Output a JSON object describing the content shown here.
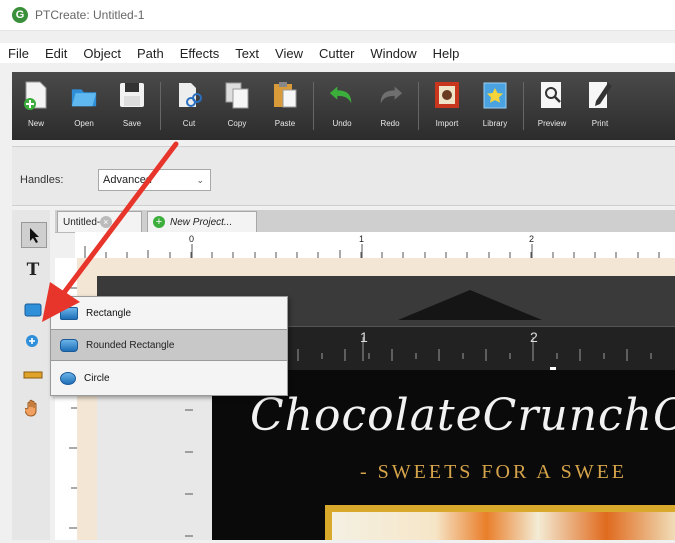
{
  "window": {
    "title": "PTCreate: Untitled-1",
    "logo_letter": "G"
  },
  "menu": [
    "File",
    "Edit",
    "Object",
    "Path",
    "Effects",
    "Text",
    "View",
    "Cutter",
    "Window",
    "Help"
  ],
  "toolbar": {
    "buttons": [
      {
        "label": "New",
        "icon": "new-document-icon"
      },
      {
        "label": "Open",
        "icon": "open-folder-icon"
      },
      {
        "label": "Save",
        "icon": "save-floppy-icon"
      },
      {
        "label": "Cut",
        "icon": "scissors-icon"
      },
      {
        "label": "Copy",
        "icon": "copy-icon"
      },
      {
        "label": "Paste",
        "icon": "paste-clipboard-icon"
      },
      {
        "label": "Undo",
        "icon": "undo-arrow-icon"
      },
      {
        "label": "Redo",
        "icon": "redo-arrow-icon"
      },
      {
        "label": "Import",
        "icon": "import-icon"
      },
      {
        "label": "Library",
        "icon": "library-star-icon"
      },
      {
        "label": "Preview",
        "icon": "preview-magnifier-icon"
      },
      {
        "label": "Print",
        "icon": "print-pen-icon"
      }
    ]
  },
  "handles": {
    "label": "Handles:",
    "value": "Advanced"
  },
  "tabs": [
    {
      "label": "Untitled-1"
    },
    {
      "label": "New Project..."
    }
  ],
  "ruler": {
    "top_marks": [
      "0",
      "1",
      "2"
    ],
    "inner_marks": [
      "1",
      "2"
    ]
  },
  "flyout": {
    "items": [
      {
        "label": "Rectangle",
        "selected": false
      },
      {
        "label": "Rounded Rectangle",
        "selected": true
      },
      {
        "label": "Circle",
        "selected": false
      }
    ]
  },
  "design": {
    "title": "ChocolateCrunchC",
    "subtitle": "- SWEETS FOR A SWEE"
  },
  "colors": {
    "toolbar": "#3a3a3a",
    "arrow": "#e8352b",
    "subtitle": "#d4a34a"
  }
}
